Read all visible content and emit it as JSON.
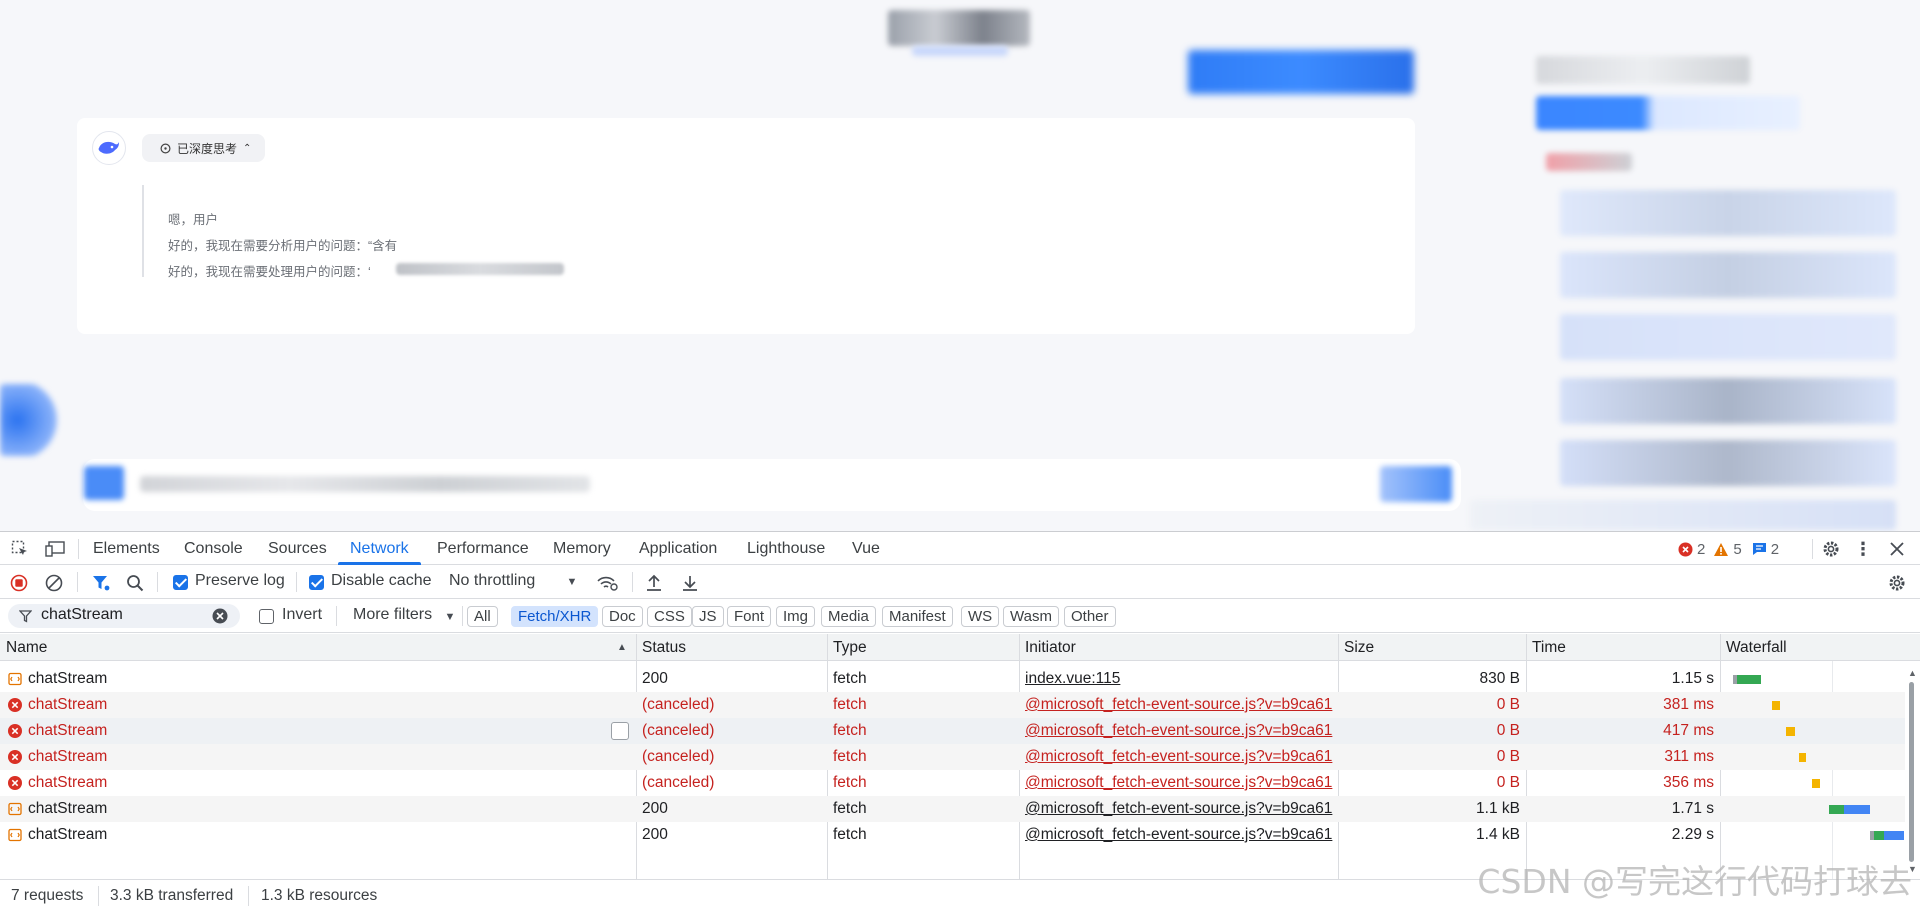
{
  "chat": {
    "think_chip_label": "已深度思考",
    "think_lines": [
      "嗯，用户",
      "好的，我现在需要分析用户的问题：“含有",
      "好的，我现在需要处理用户的问题：‘"
    ]
  },
  "devtools": {
    "tabs": [
      "Elements",
      "Console",
      "Sources",
      "Network",
      "Performance",
      "Memory",
      "Application",
      "Lighthouse",
      "Vue"
    ],
    "active_tab": "Network",
    "issues": {
      "errors": "2",
      "warnings": "5",
      "messages": "2"
    },
    "toolbar": {
      "preserve_log": "Preserve log",
      "preserve_log_checked": true,
      "disable_cache": "Disable cache",
      "disable_cache_checked": true,
      "throttling": "No throttling"
    },
    "filter": {
      "value": "chatStream",
      "invert": "Invert",
      "invert_checked": false,
      "more_filters": "More filters",
      "types": [
        "All",
        "Fetch/XHR",
        "Doc",
        "CSS",
        "JS",
        "Font",
        "Img",
        "Media",
        "Manifest",
        "WS",
        "Wasm",
        "Other"
      ],
      "active_type": "Fetch/XHR"
    },
    "columns": [
      "Name",
      "Status",
      "Type",
      "Initiator",
      "Size",
      "Time",
      "Waterfall"
    ],
    "rows": [
      {
        "name": "chatStream",
        "status": "200",
        "type": "fetch",
        "initiator": "index.vue:115",
        "size": "830 B",
        "time": "1.15 s",
        "error": false
      },
      {
        "name": "chatStream",
        "status": "(canceled)",
        "type": "fetch",
        "initiator": "@microsoft_fetch-event-source.js?v=b9ca61",
        "size": "0 B",
        "time": "381 ms",
        "error": true
      },
      {
        "name": "chatStream",
        "status": "(canceled)",
        "type": "fetch",
        "initiator": "@microsoft_fetch-event-source.js?v=b9ca61",
        "size": "0 B",
        "time": "417 ms",
        "error": true
      },
      {
        "name": "chatStream",
        "status": "(canceled)",
        "type": "fetch",
        "initiator": "@microsoft_fetch-event-source.js?v=b9ca61",
        "size": "0 B",
        "time": "311 ms",
        "error": true
      },
      {
        "name": "chatStream",
        "status": "(canceled)",
        "type": "fetch",
        "initiator": "@microsoft_fetch-event-source.js?v=b9ca61",
        "size": "0 B",
        "time": "356 ms",
        "error": true
      },
      {
        "name": "chatStream",
        "status": "200",
        "type": "fetch",
        "initiator": "@microsoft_fetch-event-source.js?v=b9ca61",
        "size": "1.1 kB",
        "time": "1.71 s",
        "error": false
      },
      {
        "name": "chatStream",
        "status": "200",
        "type": "fetch",
        "initiator": "@microsoft_fetch-event-source.js?v=b9ca61",
        "size": "1.4 kB",
        "time": "2.29 s",
        "error": false
      }
    ],
    "status": {
      "requests": "7 requests",
      "transferred": "3.3 kB transferred",
      "resources": "1.3 kB resources"
    },
    "watermark": "CSDN @写完这行代码打球去",
    "colors": {
      "accent": "#1a73e8",
      "error": "#c5221f",
      "waiting": "#34a853",
      "download": "#4285f4",
      "stalled": "#f4b400"
    }
  }
}
